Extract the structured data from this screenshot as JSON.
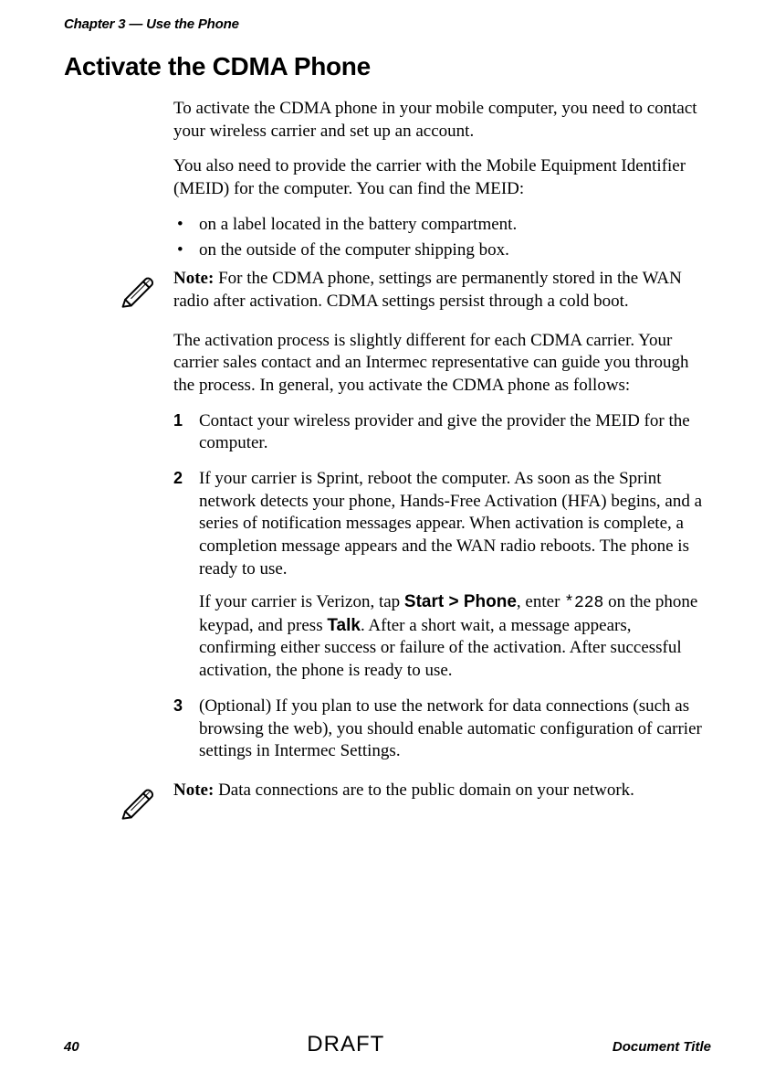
{
  "chapter_header": "Chapter 3 — Use the Phone",
  "section_title": "Activate the CDMA Phone",
  "para1": "To activate the CDMA phone in your mobile computer, you need to contact your wireless carrier and set up an account.",
  "para2": "You also need to provide the carrier with the Mobile Equipment Identifier (MEID) for the computer. You can find the MEID:",
  "bullets": [
    "on a label located in the battery compartment.",
    "on the outside of the computer shipping box."
  ],
  "note1_label": "Note:",
  "note1_text": " For the CDMA phone, settings are permanently stored in the WAN radio after activation. CDMA settings persist through a cold boot.",
  "para3": "The activation process is slightly different for each CDMA carrier. Your carrier sales contact and an Intermec representative can guide you through the process. In general, you activate the CDMA phone as follows:",
  "steps": {
    "s1_num": "1",
    "s1": "Contact your wireless provider and give the provider the MEID for the computer.",
    "s2_num": "2",
    "s2": "If your carrier is Sprint, reboot the computer. As soon as the Sprint network detects your phone, Hands-Free Activation (HFA) begins, and a series of notification messages appear. When activation is complete, a completion message appears and the WAN radio reboots. The phone is ready to use.",
    "s2b_pre": "If your carrier is Verizon, tap ",
    "s2b_startphone": "Start > Phone",
    "s2b_mid1": ", enter ",
    "s2b_code": "*228",
    "s2b_mid2": " on the phone keypad, and press ",
    "s2b_talk": "Talk",
    "s2b_post": ". After a short wait, a message appears, confirming either success or failure of the activation. After successful activation, the phone is ready to use.",
    "s3_num": "3",
    "s3": "(Optional) If you plan to use the network for data connections (such as browsing the web), you should enable automatic configuration of carrier settings in Intermec Settings."
  },
  "note2_label": "Note:",
  "note2_text": " Data connections are to the public domain on your network.",
  "footer": {
    "page_num": "40",
    "draft": "DRAFT",
    "doc_title": "Document Title"
  }
}
